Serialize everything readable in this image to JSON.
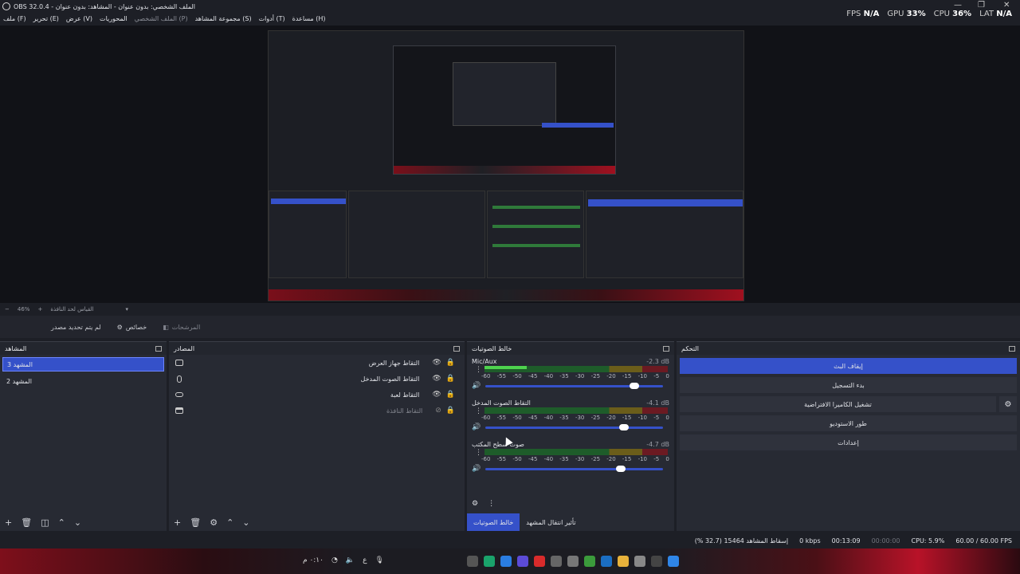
{
  "window": {
    "title": "OBS 32.0.4 - الملف الشخصي: بدون عنوان - المشاهد: بدون عنوان",
    "controls": [
      "—",
      "❐",
      "✕"
    ]
  },
  "menu": [
    {
      "label": "ملف (F)",
      "enabled": true
    },
    {
      "label": "تحرير (E)",
      "enabled": true
    },
    {
      "label": "عرض (V)",
      "enabled": true
    },
    {
      "label": "المحوريات",
      "enabled": true
    },
    {
      "label": "الملف الشخصي (P)",
      "enabled": false
    },
    {
      "label": "مجموعة المشاهد (S)",
      "enabled": true
    },
    {
      "label": "أدوات (T)",
      "enabled": true
    },
    {
      "label": "مساعدة (H)",
      "enabled": true
    }
  ],
  "stats": {
    "fps_label": "FPS",
    "fps_value": "N/A",
    "gpu_label": "GPU",
    "gpu_value": "33%",
    "cpu_label": "CPU",
    "cpu_value": "36%",
    "lat_label": "LAT",
    "lat_value": "N/A"
  },
  "zoom": {
    "minus": "−",
    "value": "46%",
    "plus": "+",
    "fit_label": "القياس لحد النافذة",
    "dropdown": "▾"
  },
  "toolbar": {
    "no_source_label": "لم يتم تحديد مصدر",
    "properties_label": "خصائص",
    "filters_label": "المرشحات"
  },
  "scenes": {
    "title": "المشاهد",
    "items": [
      {
        "label": "المشهد 3",
        "selected": true
      },
      {
        "label": "المشهد 2",
        "selected": false
      }
    ]
  },
  "sources": {
    "title": "المصادر",
    "items": [
      {
        "label": "التقاط جهاز العرض",
        "icon": "monitor-icon",
        "visible": true
      },
      {
        "label": "التقاط الصوت المدخل",
        "icon": "microphone-icon",
        "visible": true
      },
      {
        "label": "التقاط لعبة",
        "icon": "gamepad-icon",
        "visible": true
      },
      {
        "label": "التقاط النافذة",
        "icon": "window-icon",
        "visible": false
      }
    ]
  },
  "mixer": {
    "title": "خالط الصوتيات",
    "ticks": [
      "-60",
      "-55",
      "-50",
      "-45",
      "-40",
      "-35",
      "-30",
      "-25",
      "-20",
      "-15",
      "-10",
      "-5",
      "0"
    ],
    "channels": [
      {
        "name": "Mic/Aux",
        "db": "-2.3 dB",
        "level": 0.23,
        "volume": 0.84
      },
      {
        "name": "التقاط الصوت المدخل",
        "db": "-4.1 dB",
        "level": 0.0,
        "volume": 0.78
      },
      {
        "name": "صوت سطح المكتب",
        "db": "-4.7 dB",
        "level": 0.0,
        "volume": 0.76
      }
    ],
    "tabs": [
      "خالط الصوتيات",
      "تأثير انتقال المشهد"
    ]
  },
  "controls": {
    "title": "التحكم",
    "buttons": [
      {
        "label": "إيقاف البث",
        "active": true
      },
      {
        "label": "بدء التسجيل",
        "active": false
      },
      {
        "label": "تشغيل الكاميرا الافتراضية",
        "active": false
      },
      {
        "label": "طور الاستوديو",
        "active": false
      },
      {
        "label": "إعدادات",
        "active": false
      }
    ]
  },
  "status": {
    "dropped": "إسقاط المشاهد 15464 (32.7 %)",
    "kbps": "0 kbps",
    "stream_time": "00:13:09",
    "rec_time": "00:00:00",
    "cpu": "CPU: 5.9%",
    "fps": "60.00 / 60.00 FPS"
  },
  "taskbar": {
    "clock": "٠:١٠ م",
    "lang": "ع"
  },
  "colors": {
    "accent": "#3551c9",
    "meter_green": "#4ed34e"
  }
}
